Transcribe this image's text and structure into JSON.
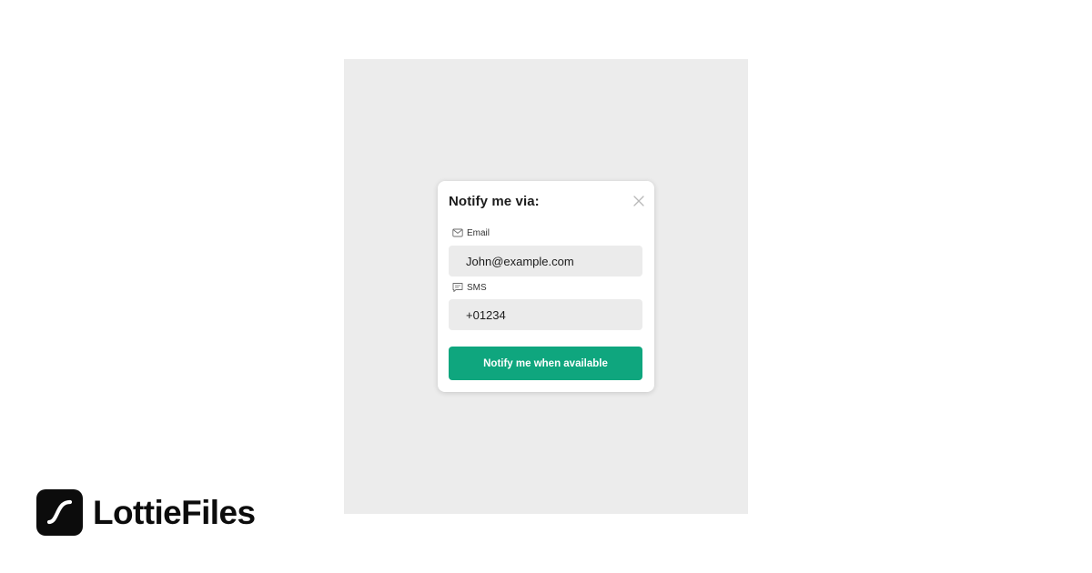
{
  "dialog": {
    "title": "Notify me via:",
    "close_icon": "close-icon",
    "email": {
      "icon": "mail-icon",
      "label": "Email",
      "value": "John@example.com"
    },
    "sms": {
      "icon": "message-icon",
      "label": "SMS",
      "value": "+01234"
    },
    "submit_label": "Notify me when available"
  },
  "brand": {
    "logo_icon": "lottiefiles-logo-icon",
    "name": "LottieFiles"
  },
  "colors": {
    "canvas_background": "#ececec",
    "accent": "#0fa67e",
    "input_background": "#ebebeb",
    "brand": "#0c0c0c"
  }
}
